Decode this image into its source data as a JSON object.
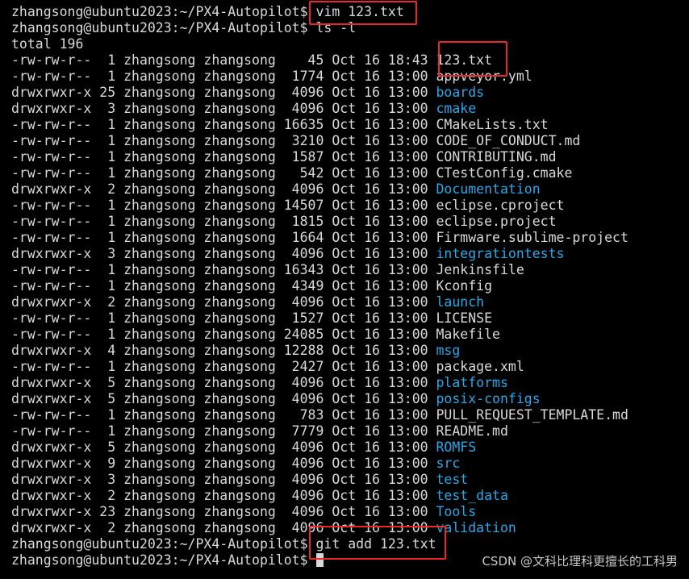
{
  "prompt": "zhangsong@ubuntu2023:~/PX4-Autopilot$",
  "commands": {
    "vim": "vim 123.txt",
    "ls": "ls -l",
    "git_add": "git add 123.txt"
  },
  "total": "total 196",
  "entries": [
    {
      "meta": "-rw-rw-r--  1 zhangsong zhangsong    45 Oct 16 18:43 ",
      "name": "123.txt",
      "type": "file"
    },
    {
      "meta": "-rw-rw-r--  1 zhangsong zhangsong  1774 Oct 16 13:00 ",
      "name": "appveyor.yml",
      "type": "file"
    },
    {
      "meta": "drwxrwxr-x 25 zhangsong zhangsong  4096 Oct 16 13:00 ",
      "name": "boards",
      "type": "dir"
    },
    {
      "meta": "drwxrwxr-x  3 zhangsong zhangsong  4096 Oct 16 13:00 ",
      "name": "cmake",
      "type": "dir"
    },
    {
      "meta": "-rw-rw-r--  1 zhangsong zhangsong 16635 Oct 16 13:00 ",
      "name": "CMakeLists.txt",
      "type": "file"
    },
    {
      "meta": "-rw-rw-r--  1 zhangsong zhangsong  3210 Oct 16 13:00 ",
      "name": "CODE_OF_CONDUCT.md",
      "type": "file"
    },
    {
      "meta": "-rw-rw-r--  1 zhangsong zhangsong  1587 Oct 16 13:00 ",
      "name": "CONTRIBUTING.md",
      "type": "file"
    },
    {
      "meta": "-rw-rw-r--  1 zhangsong zhangsong   542 Oct 16 13:00 ",
      "name": "CTestConfig.cmake",
      "type": "file"
    },
    {
      "meta": "drwxrwxr-x  2 zhangsong zhangsong  4096 Oct 16 13:00 ",
      "name": "Documentation",
      "type": "dir"
    },
    {
      "meta": "-rw-rw-r--  1 zhangsong zhangsong 14507 Oct 16 13:00 ",
      "name": "eclipse.cproject",
      "type": "file"
    },
    {
      "meta": "-rw-rw-r--  1 zhangsong zhangsong  1815 Oct 16 13:00 ",
      "name": "eclipse.project",
      "type": "file"
    },
    {
      "meta": "-rw-rw-r--  1 zhangsong zhangsong  1664 Oct 16 13:00 ",
      "name": "Firmware.sublime-project",
      "type": "file"
    },
    {
      "meta": "drwxrwxr-x  3 zhangsong zhangsong  4096 Oct 16 13:00 ",
      "name": "integrationtests",
      "type": "dir"
    },
    {
      "meta": "-rw-rw-r--  1 zhangsong zhangsong 16343 Oct 16 13:00 ",
      "name": "Jenkinsfile",
      "type": "file"
    },
    {
      "meta": "-rw-rw-r--  1 zhangsong zhangsong  4349 Oct 16 13:00 ",
      "name": "Kconfig",
      "type": "file"
    },
    {
      "meta": "drwxrwxr-x  2 zhangsong zhangsong  4096 Oct 16 13:00 ",
      "name": "launch",
      "type": "dir"
    },
    {
      "meta": "-rw-rw-r--  1 zhangsong zhangsong  1527 Oct 16 13:00 ",
      "name": "LICENSE",
      "type": "file"
    },
    {
      "meta": "-rw-rw-r--  1 zhangsong zhangsong 24085 Oct 16 13:00 ",
      "name": "Makefile",
      "type": "file"
    },
    {
      "meta": "drwxrwxr-x  4 zhangsong zhangsong 12288 Oct 16 13:00 ",
      "name": "msg",
      "type": "dir"
    },
    {
      "meta": "-rw-rw-r--  1 zhangsong zhangsong  2427 Oct 16 13:00 ",
      "name": "package.xml",
      "type": "file"
    },
    {
      "meta": "drwxrwxr-x  5 zhangsong zhangsong  4096 Oct 16 13:00 ",
      "name": "platforms",
      "type": "dir"
    },
    {
      "meta": "drwxrwxr-x  5 zhangsong zhangsong  4096 Oct 16 13:00 ",
      "name": "posix-configs",
      "type": "dir"
    },
    {
      "meta": "-rw-rw-r--  1 zhangsong zhangsong   783 Oct 16 13:00 ",
      "name": "PULL_REQUEST_TEMPLATE.md",
      "type": "file"
    },
    {
      "meta": "-rw-rw-r--  1 zhangsong zhangsong  7779 Oct 16 13:00 ",
      "name": "README.md",
      "type": "file"
    },
    {
      "meta": "drwxrwxr-x  5 zhangsong zhangsong  4096 Oct 16 13:00 ",
      "name": "ROMFS",
      "type": "dir"
    },
    {
      "meta": "drwxrwxr-x  9 zhangsong zhangsong  4096 Oct 16 13:00 ",
      "name": "src",
      "type": "dir"
    },
    {
      "meta": "drwxrwxr-x  3 zhangsong zhangsong  4096 Oct 16 13:00 ",
      "name": "test",
      "type": "dir"
    },
    {
      "meta": "drwxrwxr-x  2 zhangsong zhangsong  4096 Oct 16 13:00 ",
      "name": "test_data",
      "type": "dir"
    },
    {
      "meta": "drwxrwxr-x 23 zhangsong zhangsong  4096 Oct 16 13:00 ",
      "name": "Tools",
      "type": "dir"
    },
    {
      "meta": "drwxrwxr-x  2 zhangsong zhangsong  4096 Oct 16 13:00 ",
      "name": "validation",
      "type": "dir"
    }
  ],
  "watermark": "CSDN @文科比理科更擅长的工科男",
  "colors": {
    "background": "#000000",
    "text": "#d9d9d9",
    "directory": "#2aa7e8",
    "highlight_box": "#e8282a"
  }
}
